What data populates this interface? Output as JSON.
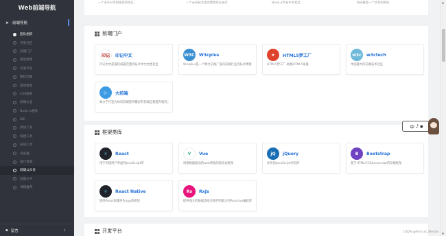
{
  "sidebar": {
    "brand": "Web前端导航",
    "section_label": "前端导航",
    "items": [
      {
        "label": "团队组织",
        "state": "active"
      },
      {
        "label": "开发社区",
        "state": "normal"
      },
      {
        "label": "前端门户",
        "state": "normal"
      },
      {
        "label": "框架类库",
        "state": "normal"
      },
      {
        "label": "开发平台",
        "state": "normal"
      },
      {
        "label": "图标动画",
        "state": "normal"
      },
      {
        "label": "游戏框架",
        "state": "normal"
      },
      {
        "label": "CSS相关",
        "state": "normal"
      },
      {
        "label": "前端大全",
        "state": "normal"
      },
      {
        "label": "Node.js相关",
        "state": "normal"
      },
      {
        "label": "IDE",
        "state": "normal"
      },
      {
        "label": "调试工具",
        "state": "normal"
      },
      {
        "label": "构建工具",
        "state": "normal"
      },
      {
        "label": "在线工具",
        "state": "normal"
      },
      {
        "label": "浏览器",
        "state": "normal"
      },
      {
        "label": "设计资源",
        "state": "normal"
      },
      {
        "label": "前端公众号",
        "state": "current"
      },
      {
        "label": "前端大牛",
        "state": "normal"
      },
      {
        "label": "书籍推荐",
        "state": "normal"
      }
    ],
    "footer": "留言"
  },
  "top_row_texts": [
    "一个关于分享和探索的地方。",
    "一个web技术类的博客杂志站点",
    "Node.js专业中文社区",
    "每天推荐一个优秀的网站"
  ],
  "portal": {
    "title": "前端门户",
    "cards": [
      {
        "name": "印记中文",
        "desc": "印记中文是最权威最完整的技术中文文档社区",
        "logo_text": "印记",
        "color": "#ffffff",
        "logo_fg": "#b4251f"
      },
      {
        "name": "W3cplus",
        "desc": "W3cplus是一个致力于推广国内前端行业的技术博客",
        "logo_text": "W3C",
        "color": "#3a8fd2",
        "logo_fg": "#ffffff"
      },
      {
        "name": "HTML5梦工厂",
        "desc": "HTML5梦工厂·助推HTML5发展",
        "logo_text": "★",
        "color": "#e0432d",
        "logo_fg": "#ffffff"
      },
      {
        "name": "w3ctech",
        "desc": "中国最大的前端技术社区",
        "logo_text": "w3c",
        "color": "#6db9d8",
        "logo_fg": "#ffffff"
      },
      {
        "name": "大前端",
        "desc": "致力于打造为你的前端提供最好的前端自我提升服务。",
        "logo_text": "▷",
        "color": "#3d9be4",
        "logo_fg": "#ffffff"
      }
    ]
  },
  "framework": {
    "title": "框架类库",
    "cards": [
      {
        "name": "React",
        "desc": "用于构建用户界面的JavaScript库",
        "logo_text": "⚛",
        "color": "#20232a",
        "logo_fg": "#61dafb"
      },
      {
        "name": "Vue",
        "desc": "构建数据驱动的web界面的渐进式框架",
        "logo_text": "V",
        "color": "#ffffff",
        "logo_fg": "#42b883"
      },
      {
        "name": "jQuery",
        "desc": "优秀的JavaScript代码库",
        "logo_text": "jQ",
        "color": "#1a6eb5",
        "logo_fg": "#ffffff"
      },
      {
        "name": "Bootstrap",
        "desc": "基于HTML/CSS/Javascript的前端框架",
        "logo_text": "B",
        "color": "#6f42c1",
        "logo_fg": "#ffffff"
      },
      {
        "name": "React Native",
        "desc": "使用React构建原生app的框架",
        "logo_text": "⚛",
        "color": "#20232a",
        "logo_fg": "#61dafb"
      },
      {
        "name": "RxJs",
        "desc": "提供强大的数据流组合和控制能力的Reactive编程库",
        "logo_text": "Rx",
        "color": "#e8157c",
        "logo_fg": "#ffffff"
      }
    ]
  },
  "dev_platform": {
    "title": "开发平台"
  },
  "float_widget": {
    "text": "中",
    "extra": "♪ ▪"
  },
  "watermark": "CSDN @Recruit_Mentor"
}
